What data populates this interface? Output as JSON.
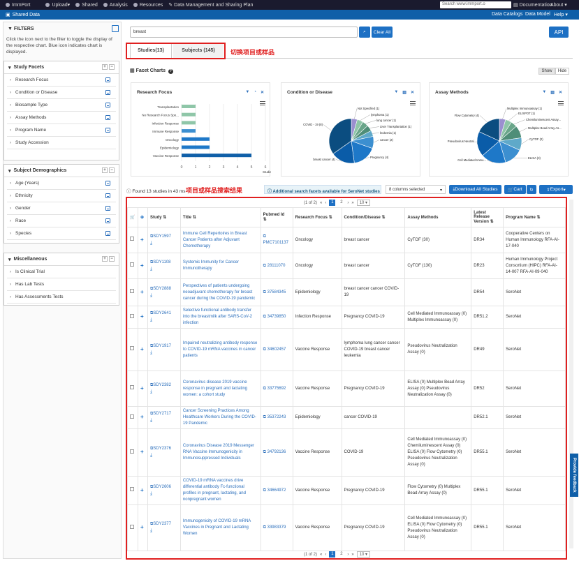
{
  "topnav": {
    "items": [
      "ImmPort",
      "Upload",
      "Shared",
      "Analysis",
      "Resources",
      "Data Management and Sharing Plan"
    ],
    "search_placeholder": "Search www.immport.o",
    "documentation": "Documentation",
    "about": "About"
  },
  "subnav": {
    "title": "Shared Data",
    "links": [
      "Data Catalogs",
      "Data Model",
      "Help"
    ]
  },
  "sidebar": {
    "title": "FILTERS",
    "help_text": "Click the icon next to the filter to toggle the display of the respective chart. Blue icon indicates chart is displayed.",
    "sections": [
      {
        "title": "Study Facets",
        "items": [
          "Research Focus",
          "Condition or Disease",
          "Biosample Type",
          "Assay Methods",
          "Program Name",
          "Study Accession"
        ]
      },
      {
        "title": "Subject Demographics",
        "items": [
          "Age (Years)",
          "Ethnicity",
          "Gender",
          "Race",
          "Species"
        ]
      },
      {
        "title": "Miscellaneous",
        "items": [
          "Is Clinical Trial",
          "Has Lab Tests",
          "Has Assessments Tests"
        ]
      }
    ]
  },
  "search": {
    "value": "breast",
    "clear_label": "Clear All",
    "api_label": "API"
  },
  "tabs": [
    "Studies(13)",
    "Subjects (145)"
  ],
  "annotation_tabs": "切换项目或样品",
  "annotation_results": "项目或样品搜索结果",
  "facet_charts": {
    "title": "Facet Charts",
    "show": "Show",
    "hide": "Hide"
  },
  "chart_data": [
    {
      "type": "bar",
      "title": "Research Focus",
      "categories": [
        "Transplantation",
        "No Research Focus Spe...",
        "Infection Response",
        "Immune Response",
        "Oncology",
        "Epidemiology",
        "Vaccine Response"
      ],
      "values": [
        1,
        1,
        1,
        1,
        2,
        2,
        5
      ],
      "xlabel": "Studies",
      "xticks": [
        "0",
        "1",
        "2",
        "3",
        "4",
        "5",
        "6"
      ],
      "xlim": [
        0,
        6
      ]
    },
    {
      "type": "pie",
      "title": "Condition or Disease",
      "labels": [
        "Not Specified (1)",
        "lymphoma (1)",
        "lung cancer (1)",
        "Liver Transplantation (1)",
        "leukemia (1)",
        "cancer (2)",
        "Pregnancy (4)",
        "breast cancer (4)",
        "COVID - 19 (8)"
      ],
      "values": [
        1,
        1,
        1,
        1,
        1,
        2,
        4,
        4,
        8
      ],
      "colors": [
        "#9b8fd0",
        "#8fc6a8",
        "#6aa68a",
        "#4f8e78",
        "#5fa9c9",
        "#3c8fd0",
        "#1e78c8",
        "#0a5ca8",
        "#0b4d80"
      ]
    },
    {
      "type": "pie",
      "title": "Assay Methods",
      "labels": [
        "Multiplex Immunoassay (1)",
        "ELISPOT (1)",
        "Chemiluminescent Assay...",
        "Multiplex Bead Array As...",
        "CyTOF (2)",
        "ELISA (3)",
        "Cell Mediated Immu...",
        "Pseudovirus Neutral...",
        "Flow Cytometry (4)"
      ],
      "values": [
        1,
        1,
        1,
        2,
        2,
        3,
        4,
        4,
        4
      ],
      "colors": [
        "#9b8fd0",
        "#8fc6a8",
        "#6aa68a",
        "#4f8e78",
        "#5fa9c9",
        "#3c8fd0",
        "#1e78c8",
        "#0a5ca8",
        "#0b4d80"
      ]
    }
  ],
  "results_bar": {
    "found": "Found 13 studies in 43 ms",
    "additional": "Additional search facets available for SeroNet studies",
    "columns_selected": "8 columns selected",
    "download": "Download All Studies",
    "cart": "Cart",
    "export": "Export"
  },
  "pager": {
    "info": "(1 of 2)",
    "pages": [
      "1",
      "2"
    ],
    "per_page": "10"
  },
  "table": {
    "headers": [
      "Study",
      "Title",
      "Pubmed Id",
      "Research Focus",
      "Condition/Disease",
      "Assay Methods",
      "Latest Release Version",
      "Program Name"
    ],
    "rows": [
      {
        "study": "SDY1597",
        "title": "Immune Cell Repertoires in Breast Cancer Patients after Adjuvant Chemotherapy",
        "pubmed": "PMC7101137",
        "focus": "Oncology",
        "condition": "breast cancer",
        "assay": "CyTOF (30)",
        "version": "DR34",
        "program": "Cooperative Centers on Human Immunology RFA-AI-17-040"
      },
      {
        "study": "SDY1108",
        "title": "Systemic Immunity for Cancer Immunotherapy",
        "pubmed": "28111070",
        "focus": "Oncology",
        "condition": "breast cancer",
        "assay": "CyTOF (130)",
        "version": "DR23",
        "program": "Human Immunology Project Consortium (HIPC) RFA-AI-14-007 RFA-AI-09-040"
      },
      {
        "study": "SDY2888",
        "title": "Perspectives of patients undergoing neoadjuvant chemotherapy for breast cancer during the COVID-19 pandemic",
        "pubmed": "37584345",
        "focus": "Epidemiology",
        "condition": "breast cancer cancer COVID-19",
        "assay": "",
        "version": "DR54",
        "program": "SeroNet"
      },
      {
        "study": "SDY2641",
        "title": "Selective functional antibody transfer into the breastmilk after SARS-CoV-2 infection",
        "pubmed": "34739850",
        "focus": "Infection Response",
        "condition": "Pregnancy COVID-19",
        "assay": "Cell Mediated Immunoassay (0) Multiplex Immunoassay (0)",
        "version": "DR51.2",
        "program": "SeroNet"
      },
      {
        "study": "SDY1917",
        "title": "Impaired neutralizing antibody response to COVID-19 mRNA vaccines in cancer patients",
        "pubmed": "34602457",
        "focus": "Vaccine Response",
        "condition": "lymphoma lung cancer cancer COVID-19 breast cancer leukemia",
        "assay": "Pseudovirus Neutralization Assay (0)",
        "version": "DR49",
        "program": "SeroNet"
      },
      {
        "study": "SDY2382",
        "title": "Coronavirus disease 2019 vaccine response in pregnant and lactating women: a cohort study",
        "pubmed": "33775692",
        "focus": "Vaccine Response",
        "condition": "Pregnancy COVID-19",
        "assay": "ELISA (0) Multiplex Bead Array Assay (0) Pseudovirus Neutralization Assay (0)",
        "version": "DR52",
        "program": "SeroNet"
      },
      {
        "study": "SDY2717",
        "title": "Cancer Screening Practices Among Healthcare Workers During the COVID-19 Pandemic",
        "pubmed": "35372243",
        "focus": "Epidemiology",
        "condition": "cancer COVID-19",
        "assay": "",
        "version": "DR52.1",
        "program": "SeroNet"
      },
      {
        "study": "SDY2376",
        "title": "Coronavirus Disease 2019 Messenger RNA Vaccine Immunogenicity in Immunosuppressed Individuals",
        "pubmed": "34792136",
        "focus": "Vaccine Response",
        "condition": "COVID-19",
        "assay": "Cell Mediated Immunoassay (0) Chemiluminescent Assay (0) ELISA (0) Flow Cytometry (0) Pseudovirus Neutralization Assay (0)",
        "version": "DR55.1",
        "program": "SeroNet"
      },
      {
        "study": "SDY2606",
        "title": "COVID-19 mRNA vaccines drive differential antibody Fc-functional profiles in pregnant, lactating, and nonpregnant women",
        "pubmed": "34664972",
        "focus": "Vaccine Response",
        "condition": "Pregnancy COVID-19",
        "assay": "Flow Cytometry (0) Multiplex Bead Array Assay (0)",
        "version": "DR55.1",
        "program": "SeroNet"
      },
      {
        "study": "SDY2377",
        "title": "Immunogenicity of COVID-19 mRNA Vaccines in Pregnant and Lactating Women",
        "pubmed": "33983379",
        "focus": "Vaccine Response",
        "condition": "Pregnancy COVID-19",
        "assay": "Cell Mediated Immunoassay (0) ELISA (0) Flow Cytometry (0) Pseudovirus Neutralization Assay (0)",
        "version": "DR55.1",
        "program": "SeroNet"
      }
    ]
  },
  "feedback": "Provide feedback"
}
